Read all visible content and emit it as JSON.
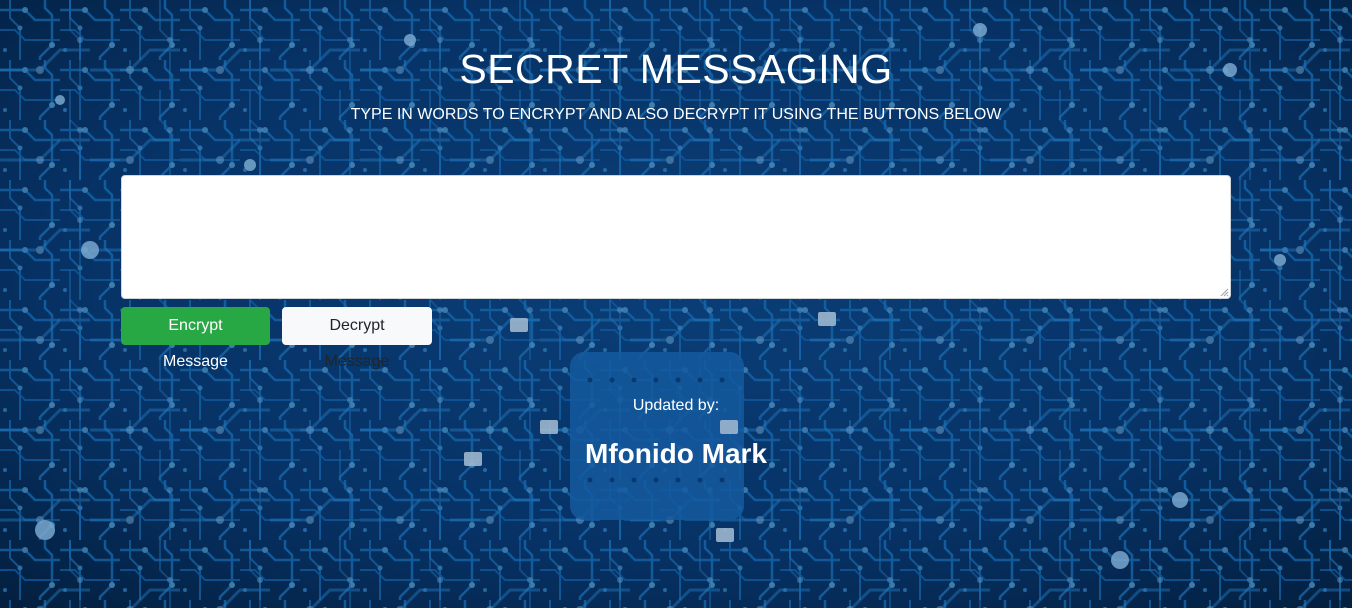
{
  "header": {
    "title": "SECRET MESSAGING",
    "subtitle": "TYPE IN WORDS TO ENCRYPT AND ALSO DECRYPT IT USING THE BUTTONS BELOW"
  },
  "editor": {
    "value": "",
    "placeholder": ""
  },
  "actions": {
    "encrypt_label": "Encrypt Message",
    "decrypt_label": "Decrypt Message"
  },
  "footer": {
    "updated_label": "Updated by:",
    "author": "Mfonido Mark"
  },
  "colors": {
    "background": "#062a5a",
    "circuit": "#1e88d8",
    "encrypt_button": "#28a745",
    "decrypt_button": "#f8f9fa",
    "text": "#ffffff"
  }
}
